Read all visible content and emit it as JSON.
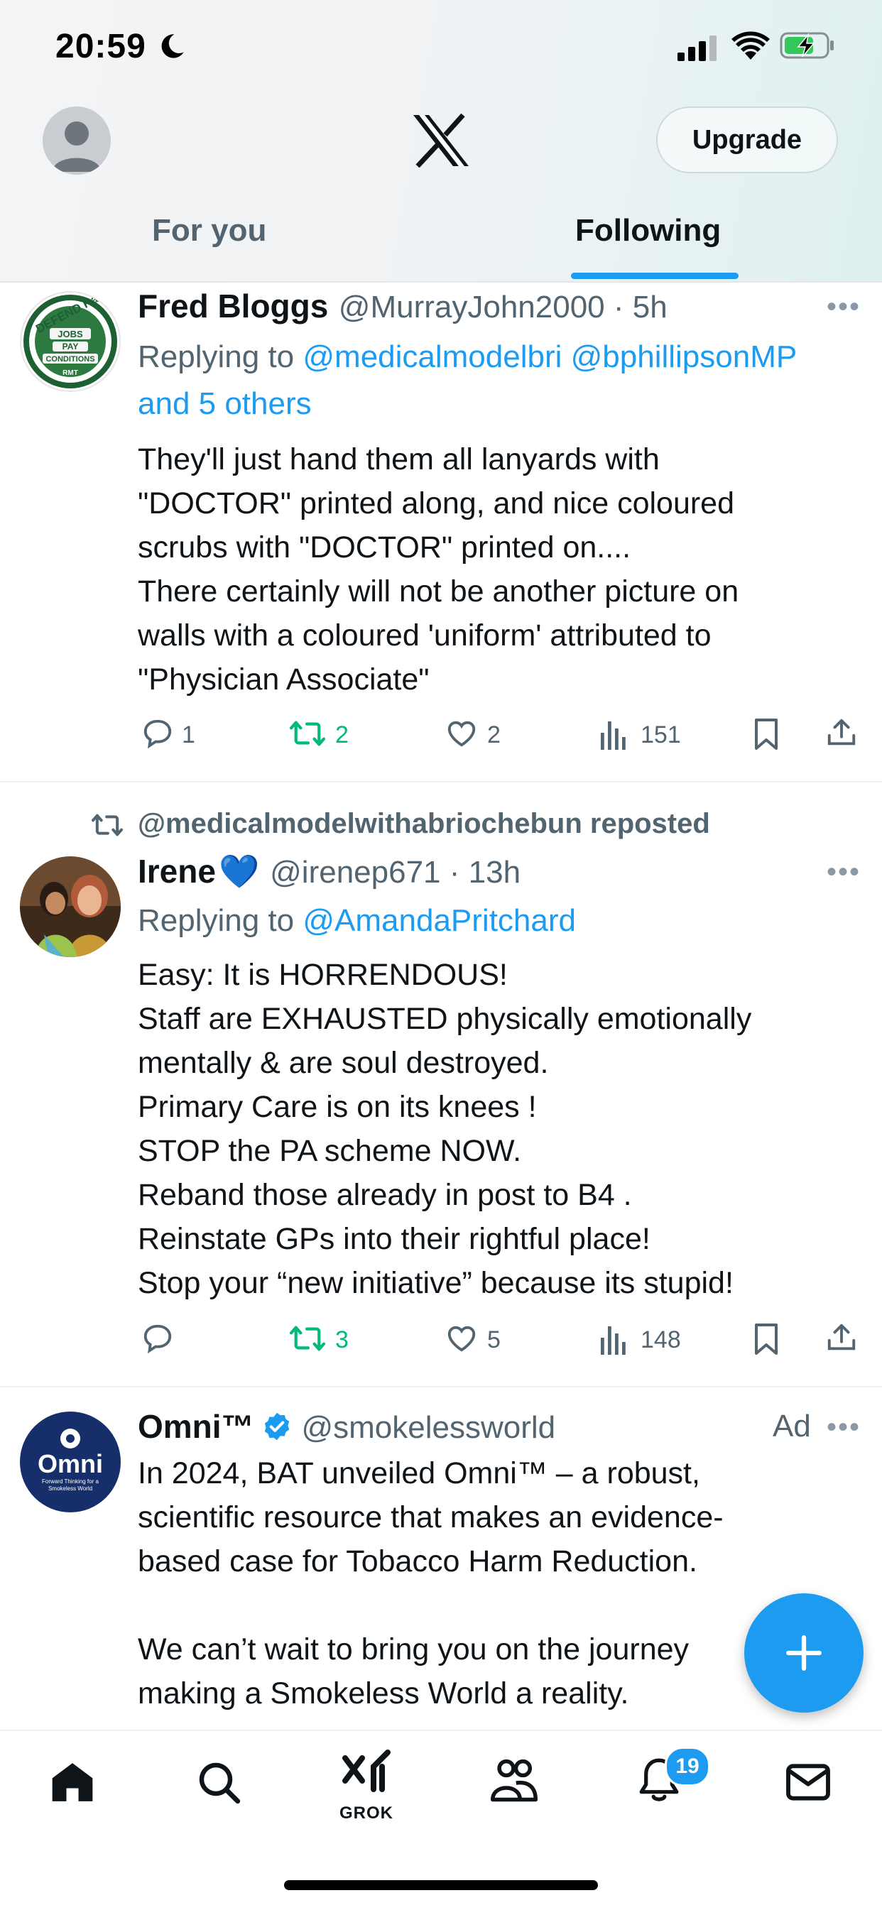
{
  "status_bar": {
    "time": "20:59"
  },
  "header": {
    "upgrade_label": "Upgrade",
    "tabs": [
      {
        "label": "For you",
        "selected": false
      },
      {
        "label": "Following",
        "selected": true
      }
    ]
  },
  "tweets": [
    {
      "name": "Fred Bloggs",
      "handle": "@MurrayJohn2000",
      "time": "5h",
      "replying_prefix": "Replying to",
      "replying_line1": "@medicalmodelbri @bphillipsonMP",
      "replying_line2": "and 5 others",
      "avatar_text": [
        "DEFEND Rail",
        "JOBS",
        "PAY",
        "CONDITIONS",
        "RMT"
      ],
      "text": "They'll just hand them all lanyards with\n\"DOCTOR\" printed along, and nice coloured\nscrubs with \"DOCTOR\" printed on....\nThere certainly will not be another picture on\nwalls with a coloured 'uniform' attributed to\n\"Physician Associate\"",
      "replies": "1",
      "reposts": "2",
      "likes": "2",
      "views": "151"
    },
    {
      "repost_by": "@medicalmodelwithabriochebun reposted",
      "name": "Irene",
      "emoji": "💙",
      "handle": "@irenep671",
      "time": "13h",
      "replying_prefix": "Replying to",
      "replying_line1": "@AmandaPritchard",
      "text": "Easy: It is HORRENDOUS!\nStaff are EXHAUSTED physically emotionally\nmentally & are soul destroyed.\nPrimary Care is on its knees !\nSTOP the PA scheme NOW.\nReband those already in post to B4 .\nReinstate GPs into their rightful place!\nStop your “new initiative” because its stupid!",
      "replies": "",
      "reposts": "3",
      "likes": "5",
      "views": "148"
    },
    {
      "name": "Omni™",
      "handle": "@smokelessworld",
      "ad_label": "Ad",
      "avatar_text": "Omni",
      "avatar_subtext": "Forward Thinking for a Smokeless World",
      "text": "In 2024, BAT unveiled Omni™ – a robust,\nscientific resource that makes an evidence-\nbased case for Tobacco Harm Reduction.\n\nWe can’t wait to bring you on the journey\nmaking a Smokeless World a reality."
    }
  ],
  "nav": {
    "grok_label": "GROK",
    "notification_count": "19"
  },
  "colors": {
    "accent": "#1d9bf0",
    "repost_green": "#00ba7c",
    "secondary_text": "#536471"
  }
}
